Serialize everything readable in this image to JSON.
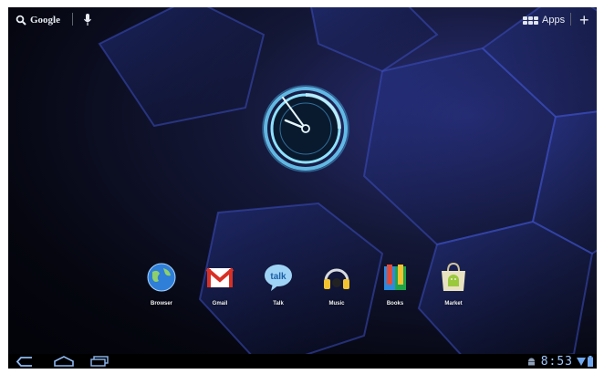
{
  "topbar": {
    "search_label": "Google",
    "apps_label": "Apps",
    "add_label": "+"
  },
  "clock": {
    "hour_hand_time": "8:53"
  },
  "dock": {
    "apps": [
      {
        "label": "Browser",
        "icon": "browser-globe-icon"
      },
      {
        "label": "Gmail",
        "icon": "gmail-envelope-icon"
      },
      {
        "label": "Talk",
        "icon": "talk-bubble-icon"
      },
      {
        "label": "Music",
        "icon": "music-headphones-icon"
      },
      {
        "label": "Books",
        "icon": "books-icon"
      },
      {
        "label": "Market",
        "icon": "market-bag-icon"
      }
    ]
  },
  "statusbar": {
    "time": "8:53",
    "icons": [
      "android-debug-icon",
      "wifi-icon",
      "battery-icon"
    ]
  },
  "navigation": {
    "icons": [
      "back-icon",
      "home-icon",
      "recent-apps-icon"
    ]
  },
  "colors": {
    "accent": "#9ec6ff",
    "background": "#05060f"
  }
}
